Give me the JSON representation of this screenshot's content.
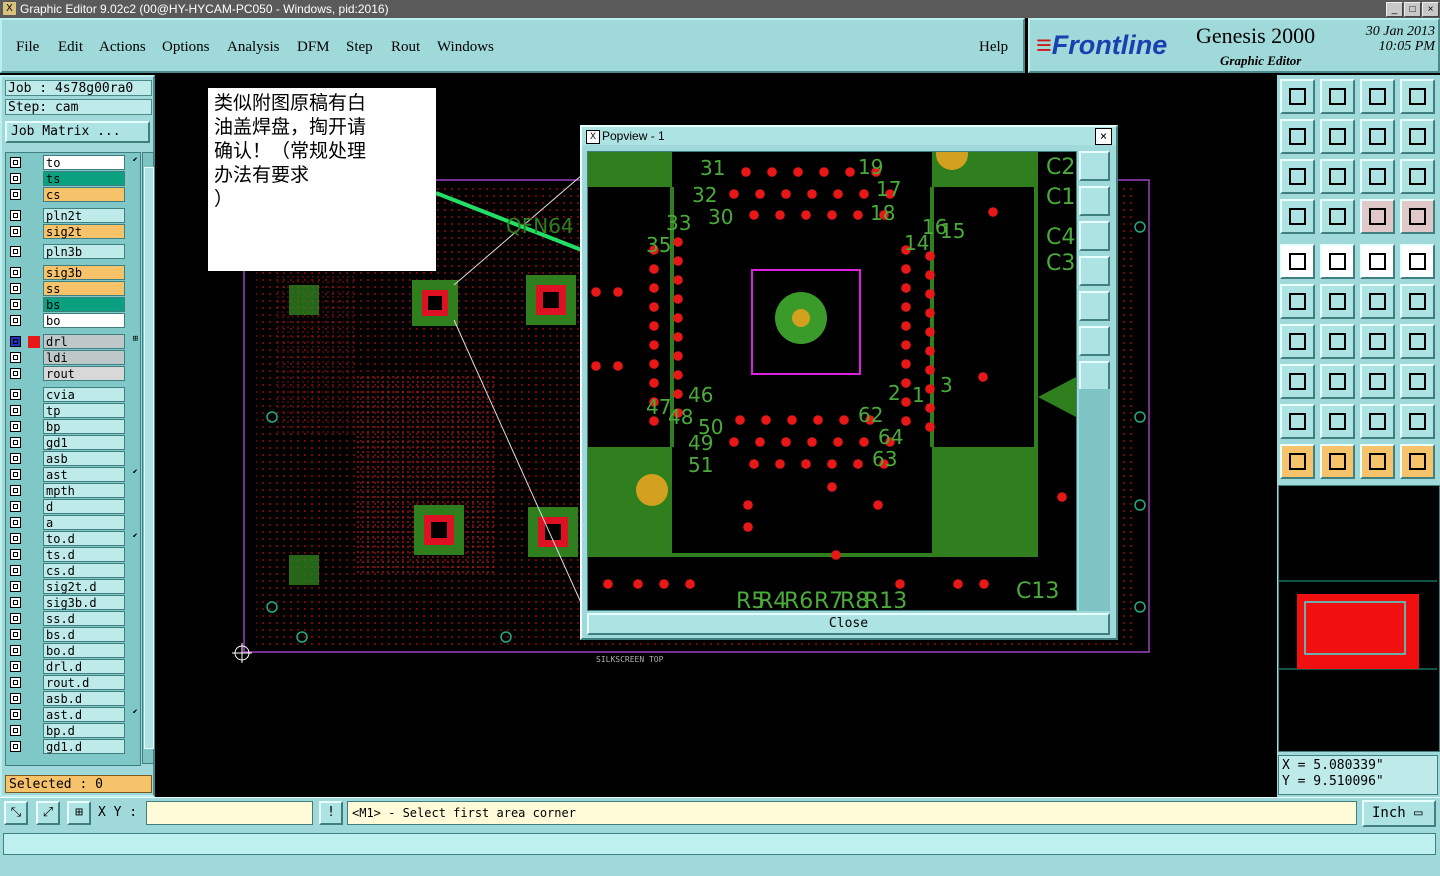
{
  "window": {
    "title": "Graphic Editor 9.02c2 (00@HY-HYCAM-PC050 - Windows, pid:2016)",
    "buttons": [
      "_",
      "□",
      "×"
    ]
  },
  "menu": {
    "items": [
      "File",
      "Edit",
      "Actions",
      "Options",
      "Analysis",
      "DFM",
      "Step",
      "Rout",
      "Windows"
    ],
    "help": "Help"
  },
  "brand": {
    "logo": "Frontline",
    "product": "Genesis 2000",
    "subtitle": "Graphic Editor",
    "date": "30 Jan 2013",
    "time": "10:05 PM"
  },
  "left": {
    "job": "Job : 4s78g00ra0",
    "step": "Step: cam",
    "job_matrix": "Job Matrix ...",
    "selected": "Selected : 0",
    "layers": [
      {
        "name": "to",
        "color": "#ffffff",
        "mark": "⬋"
      },
      {
        "name": "ts",
        "color": "#0aa080",
        "mark": ""
      },
      {
        "name": "cs",
        "color": "#f6c36b",
        "mark": ""
      },
      {
        "name": "pln2t",
        "color": "#bfeaea",
        "mark": ""
      },
      {
        "name": "sig2t",
        "color": "#f6c36b",
        "mark": ""
      },
      {
        "name": "pln3b",
        "color": "#bfeaea",
        "mark": ""
      },
      {
        "name": "sig3b",
        "color": "#f6c36b",
        "mark": ""
      },
      {
        "name": "ss",
        "color": "#f6c36b",
        "mark": ""
      },
      {
        "name": "bs",
        "color": "#0aa080",
        "mark": ""
      },
      {
        "name": "bo",
        "color": "#ffffff",
        "mark": ""
      },
      {
        "name": "drl",
        "color": "#bfc8c8",
        "mark": "⊞"
      },
      {
        "name": "ldi",
        "color": "#bfc8c8",
        "mark": ""
      },
      {
        "name": "rout",
        "color": "#d8d8d8",
        "mark": ""
      },
      {
        "name": "cvia",
        "color": "#bfeaea",
        "mark": ""
      },
      {
        "name": "tp",
        "color": "#bfeaea",
        "mark": ""
      },
      {
        "name": "bp",
        "color": "#bfeaea",
        "mark": ""
      },
      {
        "name": "gd1",
        "color": "#bfeaea",
        "mark": ""
      },
      {
        "name": "asb",
        "color": "#bfeaea",
        "mark": ""
      },
      {
        "name": "ast",
        "color": "#bfeaea",
        "mark": "⬋"
      },
      {
        "name": "mpth",
        "color": "#bfeaea",
        "mark": ""
      },
      {
        "name": "d",
        "color": "#bfeaea",
        "mark": ""
      },
      {
        "name": "a",
        "color": "#bfeaea",
        "mark": ""
      },
      {
        "name": "to.d",
        "color": "#bfeaea",
        "mark": "⬋"
      },
      {
        "name": "ts.d",
        "color": "#bfeaea",
        "mark": ""
      },
      {
        "name": "cs.d",
        "color": "#bfeaea",
        "mark": ""
      },
      {
        "name": "sig2t.d",
        "color": "#bfeaea",
        "mark": ""
      },
      {
        "name": "sig3b.d",
        "color": "#bfeaea",
        "mark": ""
      },
      {
        "name": "ss.d",
        "color": "#bfeaea",
        "mark": ""
      },
      {
        "name": "bs.d",
        "color": "#bfeaea",
        "mark": ""
      },
      {
        "name": "bo.d",
        "color": "#bfeaea",
        "mark": ""
      },
      {
        "name": "drl.d",
        "color": "#bfeaea",
        "mark": ""
      },
      {
        "name": "rout.d",
        "color": "#bfeaea",
        "mark": ""
      },
      {
        "name": "asb.d",
        "color": "#bfeaea",
        "mark": ""
      },
      {
        "name": "ast.d",
        "color": "#bfeaea",
        "mark": "⬋"
      },
      {
        "name": "bp.d",
        "color": "#bfeaea",
        "mark": ""
      },
      {
        "name": "gd1.d",
        "color": "#bfeaea",
        "mark": ""
      }
    ]
  },
  "canvas": {
    "silkscreen_label": "SILKSCREEN TOP",
    "qfn_label": "QFN64",
    "note_lines": [
      "类似附图原稿有白",
      "油盖焊盘，掏开请",
      "确认！（常规处理",
      "办法有要求",
      "）"
    ]
  },
  "popview": {
    "title": "Popview - 1",
    "close_label": "Close",
    "pin_labels": [
      "31",
      "19",
      "32",
      "17",
      "30",
      "18",
      "33",
      "14",
      "16",
      "35",
      "15",
      "47",
      "2",
      "3",
      "48",
      "1",
      "46",
      "50",
      "49",
      "62",
      "64",
      "51",
      "63"
    ],
    "ref_labels": [
      "C2",
      "C1",
      "C4",
      "C3",
      "R5",
      "R4",
      "R6",
      "R7",
      "R8",
      "R13",
      "C13"
    ]
  },
  "right": {
    "coord_x": "X  =  5.080339\"",
    "coord_y": "Y  =  9.510096\""
  },
  "bottom": {
    "xy_label": "X Y :",
    "xy_value": "",
    "prompt": "<M1> - Select first area corner",
    "unit": "Inch"
  }
}
